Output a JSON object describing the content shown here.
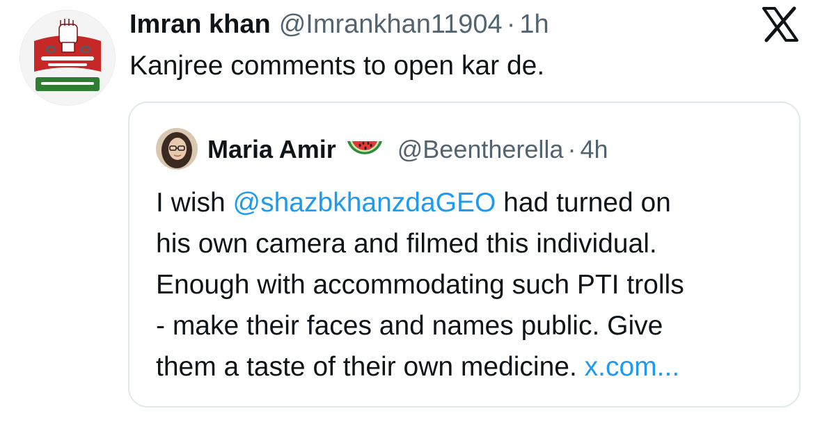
{
  "tweet": {
    "author_name": "Imran khan",
    "author_handle": "@Imrankhan11904",
    "separator": "·",
    "time": "1h",
    "text": "Kanjree comments to open kar de."
  },
  "quoted": {
    "author_name": "Maria Amir",
    "author_handle": "@Beentherella",
    "separator": "·",
    "time": "4h",
    "lines": [
      {
        "before": "I wish ",
        "mention": "@shazbkhanzdaGEO",
        "after": " had turned on"
      },
      {
        "text": "his own camera and filmed this individual."
      },
      {
        "text": "Enough with accommodating such PTI trolls"
      },
      {
        "text": "- make their faces and names public. Give"
      },
      {
        "before": "them a taste of their own medicine. ",
        "link": "x.com..."
      }
    ]
  },
  "icons": {
    "platform_logo": "x-logo-icon",
    "emoji": "watermelon-icon"
  },
  "colors": {
    "text_primary": "#0f1419",
    "text_secondary": "#536471",
    "link": "#1d9bf0",
    "border": "#e1e8ed"
  }
}
